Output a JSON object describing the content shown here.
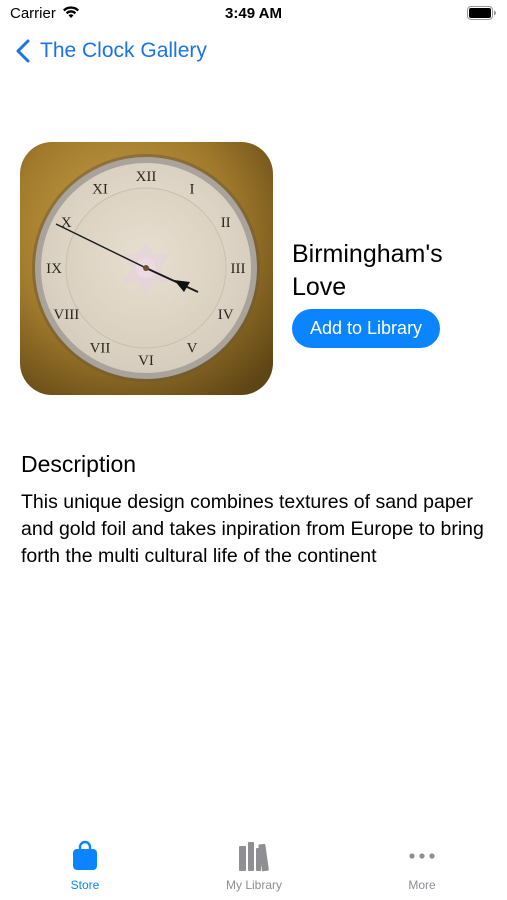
{
  "status_bar": {
    "carrier": "Carrier",
    "time": "3:49 AM"
  },
  "nav": {
    "back_label": "The Clock Gallery"
  },
  "product": {
    "title": "Birmingham's Love",
    "add_button_label": "Add to Library",
    "artwork": {
      "numerals": [
        "XII",
        "I",
        "II",
        "III",
        "IV",
        "V",
        "VI",
        "VII",
        "VIII",
        "IX",
        "X",
        "XI"
      ]
    }
  },
  "description": {
    "heading": "Description",
    "body": "This unique design combines textures of sand paper and gold foil and takes inpiration from Europe to bring forth the multi cultural life of the continent"
  },
  "tab_bar": {
    "active_color": "#0a84ff",
    "inactive_color": "#8e8e93",
    "tabs": [
      {
        "label": "Store",
        "icon": "bag-icon",
        "active": true
      },
      {
        "label": "My Library",
        "icon": "books-icon",
        "active": false
      },
      {
        "label": "More",
        "icon": "ellipsis-icon",
        "active": false
      }
    ]
  }
}
